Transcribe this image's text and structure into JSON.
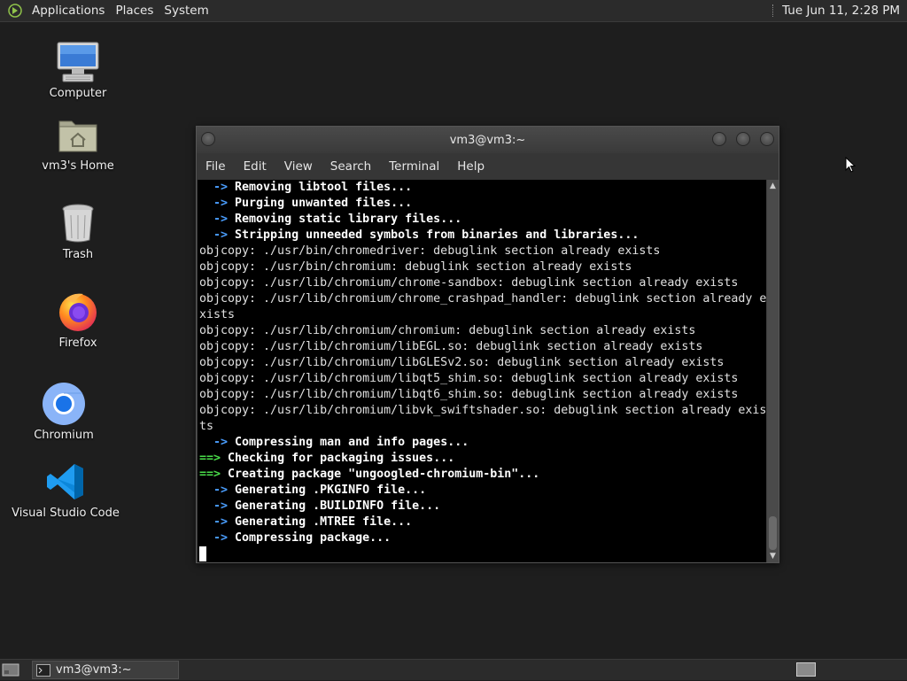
{
  "top_panel": {
    "menus": [
      "Applications",
      "Places",
      "System"
    ],
    "clock": "Tue Jun 11,  2:28 PM"
  },
  "desktop_icons": [
    {
      "label": "Computer",
      "icon": "computer-icon"
    },
    {
      "label": "vm3's Home",
      "icon": "home-folder-icon"
    },
    {
      "label": "Trash",
      "icon": "trash-icon"
    },
    {
      "label": "Firefox",
      "icon": "firefox-icon"
    },
    {
      "label": "Chromium",
      "icon": "chromium-icon"
    },
    {
      "label": "Visual Studio Code",
      "icon": "vscode-icon"
    }
  ],
  "terminal": {
    "title": "vm3@vm3:~",
    "menu": [
      "File",
      "Edit",
      "View",
      "Search",
      "Terminal",
      "Help"
    ],
    "lines": [
      {
        "prefix": "  -> ",
        "prefix_type": "arrow",
        "text": "Removing libtool files...",
        "bold": true
      },
      {
        "prefix": "  -> ",
        "prefix_type": "arrow",
        "text": "Purging unwanted files...",
        "bold": true
      },
      {
        "prefix": "  -> ",
        "prefix_type": "arrow",
        "text": "Removing static library files...",
        "bold": true
      },
      {
        "prefix": "  -> ",
        "prefix_type": "arrow",
        "text": "Stripping unneeded symbols from binaries and libraries...",
        "bold": true
      },
      {
        "prefix": "",
        "prefix_type": "none",
        "text": "objcopy: ./usr/bin/chromedriver: debuglink section already exists",
        "bold": false
      },
      {
        "prefix": "",
        "prefix_type": "none",
        "text": "objcopy: ./usr/bin/chromium: debuglink section already exists",
        "bold": false
      },
      {
        "prefix": "",
        "prefix_type": "none",
        "text": "objcopy: ./usr/lib/chromium/chrome-sandbox: debuglink section already exists",
        "bold": false
      },
      {
        "prefix": "",
        "prefix_type": "none",
        "text": "objcopy: ./usr/lib/chromium/chrome_crashpad_handler: debuglink section already e",
        "bold": false
      },
      {
        "prefix": "",
        "prefix_type": "none",
        "text": "xists",
        "bold": false
      },
      {
        "prefix": "",
        "prefix_type": "none",
        "text": "objcopy: ./usr/lib/chromium/chromium: debuglink section already exists",
        "bold": false
      },
      {
        "prefix": "",
        "prefix_type": "none",
        "text": "objcopy: ./usr/lib/chromium/libEGL.so: debuglink section already exists",
        "bold": false
      },
      {
        "prefix": "",
        "prefix_type": "none",
        "text": "objcopy: ./usr/lib/chromium/libGLESv2.so: debuglink section already exists",
        "bold": false
      },
      {
        "prefix": "",
        "prefix_type": "none",
        "text": "objcopy: ./usr/lib/chromium/libqt5_shim.so: debuglink section already exists",
        "bold": false
      },
      {
        "prefix": "",
        "prefix_type": "none",
        "text": "objcopy: ./usr/lib/chromium/libqt6_shim.so: debuglink section already exists",
        "bold": false
      },
      {
        "prefix": "",
        "prefix_type": "none",
        "text": "objcopy: ./usr/lib/chromium/libvk_swiftshader.so: debuglink section already exis",
        "bold": false
      },
      {
        "prefix": "",
        "prefix_type": "none",
        "text": "ts",
        "bold": false
      },
      {
        "prefix": "  -> ",
        "prefix_type": "arrow",
        "text": "Compressing man and info pages...",
        "bold": true
      },
      {
        "prefix": "==> ",
        "prefix_type": "garrow",
        "text": "Checking for packaging issues...",
        "bold": true
      },
      {
        "prefix": "==> ",
        "prefix_type": "garrow",
        "text": "Creating package \"ungoogled-chromium-bin\"...",
        "bold": true
      },
      {
        "prefix": "  -> ",
        "prefix_type": "arrow",
        "text": "Generating .PKGINFO file...",
        "bold": true
      },
      {
        "prefix": "  -> ",
        "prefix_type": "arrow",
        "text": "Generating .BUILDINFO file...",
        "bold": true
      },
      {
        "prefix": "  -> ",
        "prefix_type": "arrow",
        "text": "Generating .MTREE file...",
        "bold": true
      },
      {
        "prefix": "  -> ",
        "prefix_type": "arrow",
        "text": "Compressing package...",
        "bold": true
      }
    ]
  },
  "taskbar": {
    "task_label": "vm3@vm3:~"
  },
  "colors": {
    "arrow": "#4a9eff",
    "green_arrow": "#4ade4a",
    "terminal_bg": "#000000",
    "desktop_bg": "#1e1e1e"
  }
}
